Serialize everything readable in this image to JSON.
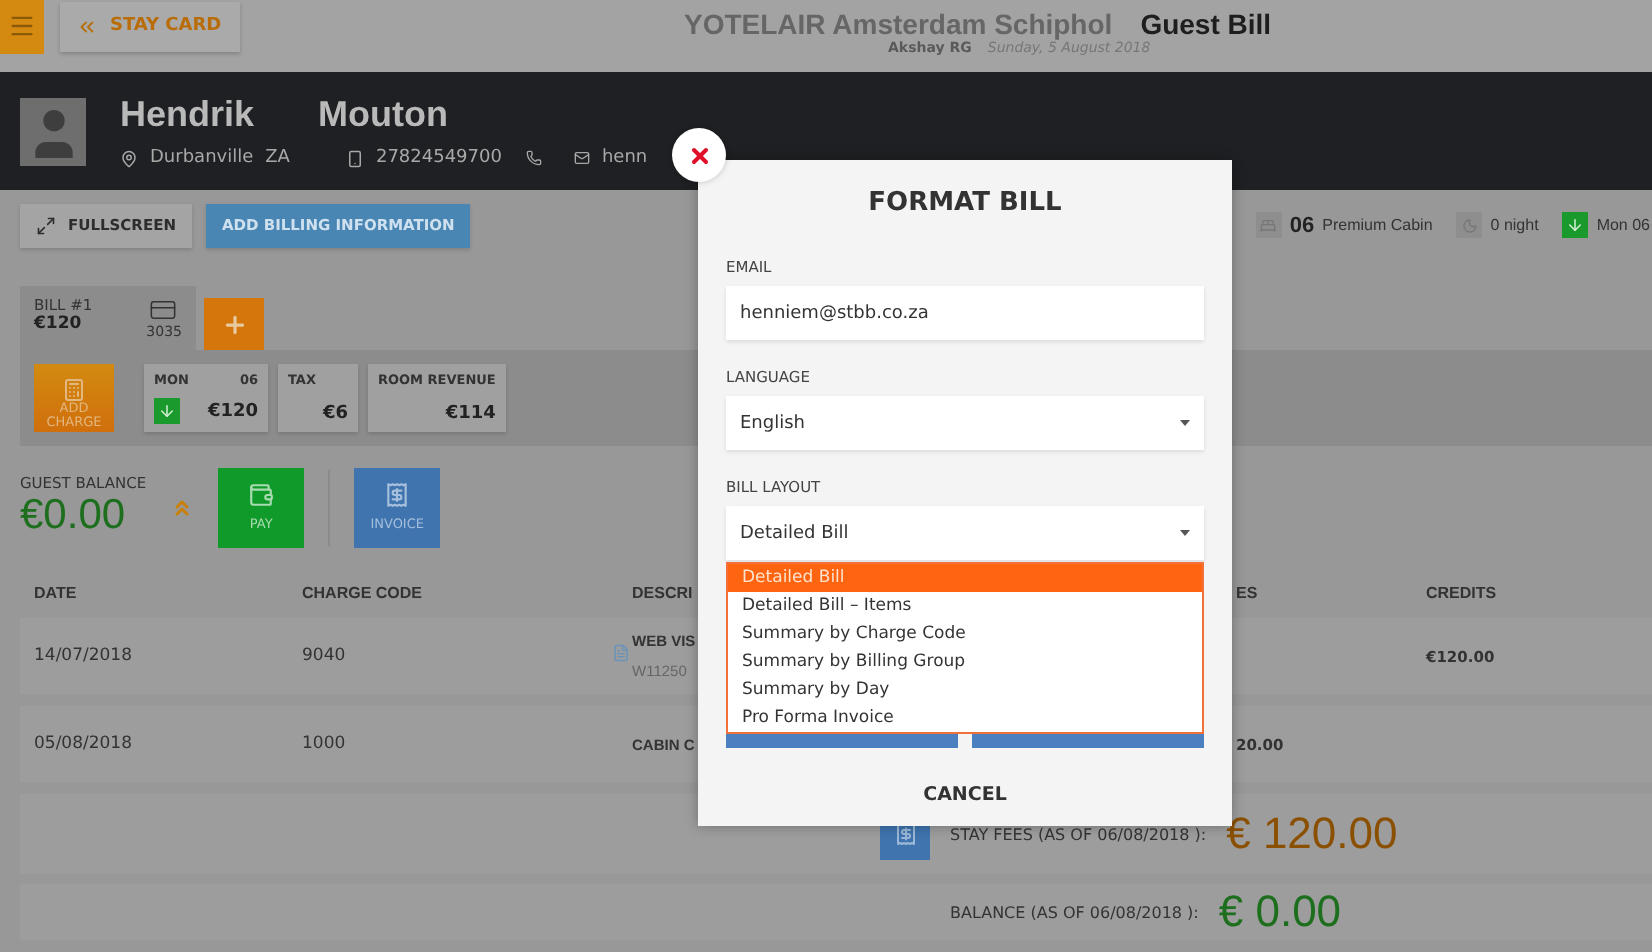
{
  "top_bar": {
    "back_button": "STAY CARD",
    "hotel_name": "YOTELAIR Amsterdam Schiphol",
    "page_title": "Guest Bill",
    "user": "Akshay RG",
    "date": "Sunday, 5 August 2018"
  },
  "guest": {
    "first_name": "Hendrik",
    "last_name": "Mouton",
    "city": "Durbanville",
    "country": "ZA",
    "phone": "27824549700",
    "email": "henn"
  },
  "toolbar": {
    "buttons": [
      {
        "label": "FULLSCREEN",
        "kind": "plain"
      },
      {
        "label": "ADD BILLING INFORMATION",
        "kind": "primary"
      }
    ],
    "room_number": "06",
    "room_type": "Premium Cabin",
    "nights": "0 night",
    "arrival": "Mon 06"
  },
  "bill": {
    "tab_label": "BILL #1",
    "tab_amount": "€120",
    "card_number": "3035",
    "add_charge": "ADD CHARGE",
    "summary_cards": [
      {
        "label": "MON",
        "day": "06",
        "amount": "€120",
        "kind": "day"
      },
      {
        "label": "TAX",
        "amount": "€6",
        "kind": "plain"
      },
      {
        "label": "ROOM REVENUE",
        "amount": "€114",
        "kind": "plain"
      }
    ]
  },
  "balance": {
    "label": "GUEST BALANCE",
    "amount": "€0.00",
    "actions": [
      {
        "label": "PAY",
        "kind": "pay"
      },
      {
        "label": "INVOICE",
        "kind": "invoice"
      }
    ]
  },
  "table": {
    "columns": [
      "DATE",
      "CHARGE CODE",
      "DESCRI",
      "ES",
      "CREDITS"
    ],
    "rows": [
      {
        "date": "14/07/2018",
        "charge_code": "9040",
        "attachment": true,
        "description": "WEB VIS",
        "reference": "W11250",
        "credits": "€120.00"
      },
      {
        "date": "05/08/2018",
        "charge_code": "1000",
        "attachment": false,
        "description": "CABIN C",
        "charges": "20.00"
      }
    ]
  },
  "totals": [
    {
      "label": "STAY FEES (AS OF 06/08/2018 ):",
      "amount": "€ 120.00",
      "kind": "fees"
    },
    {
      "label": "BALANCE (AS OF 06/08/2018 ):",
      "amount": "€ 0.00",
      "kind": "balance"
    }
  ],
  "dialog": {
    "title": "FORMAT BILL",
    "email_label": "EMAIL",
    "email": "henniem@stbb.co.za",
    "language_label": "LANGUAGE",
    "language": "English",
    "layout_label": "BILL LAYOUT",
    "layout": "Detailed Bill",
    "layout_options": [
      {
        "label": "Detailed Bill",
        "selected": true
      },
      {
        "label": "Detailed Bill – Items",
        "selected": false
      },
      {
        "label": "Summary by Charge Code",
        "selected": false
      },
      {
        "label": "Summary by Billing Group",
        "selected": false
      },
      {
        "label": "Summary by Day",
        "selected": false
      },
      {
        "label": "Pro Forma Invoice",
        "selected": false
      }
    ],
    "cancel": "CANCEL"
  }
}
